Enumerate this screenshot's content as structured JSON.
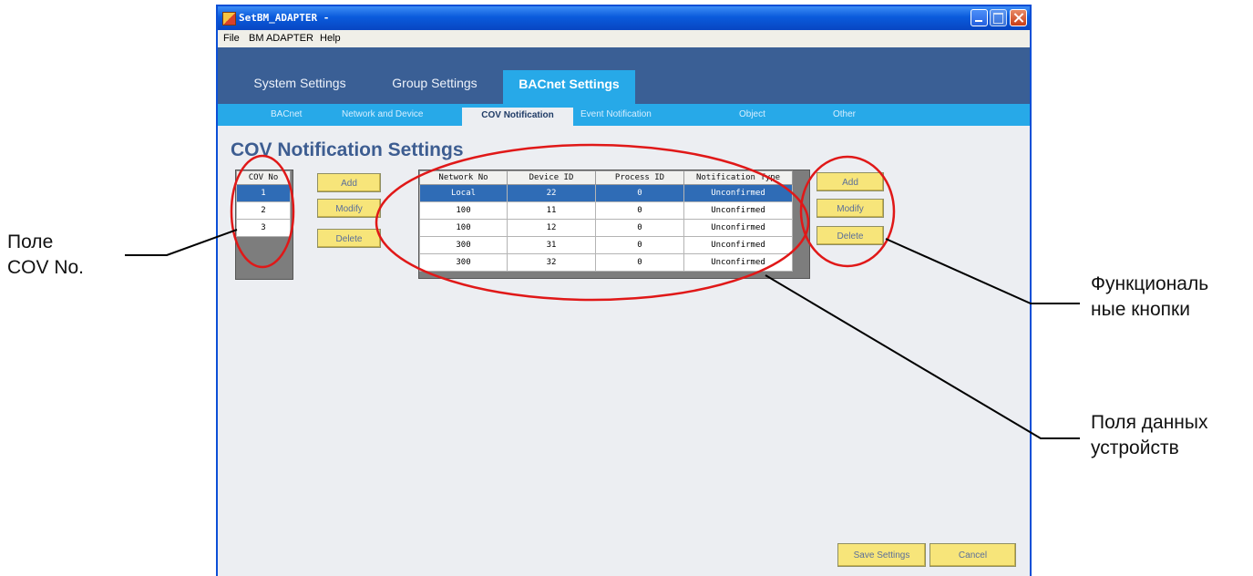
{
  "window": {
    "title": "SetBM_ADAPTER -",
    "menu": [
      "File",
      "BM ADAPTER",
      "Help"
    ]
  },
  "tabs": {
    "main": [
      "System Settings",
      "Group Settings",
      "BACnet Settings"
    ],
    "sub": [
      "BACnet",
      "Network and Device",
      "COV Notification",
      "Event Notification",
      "Object",
      "Other"
    ]
  },
  "page_title": "COV Notification Settings",
  "cov_list": {
    "header": "COV No",
    "items": [
      "1",
      "2",
      "3"
    ],
    "selected": "1"
  },
  "device_table": {
    "columns": [
      "Network No",
      "Device ID",
      "Process ID",
      "Notification Type"
    ],
    "rows": [
      [
        "Local",
        "22",
        "0",
        "Unconfirmed"
      ],
      [
        "100",
        "11",
        "0",
        "Unconfirmed"
      ],
      [
        "100",
        "12",
        "0",
        "Unconfirmed"
      ],
      [
        "300",
        "31",
        "0",
        "Unconfirmed"
      ],
      [
        "300",
        "32",
        "0",
        "Unconfirmed"
      ]
    ],
    "selected_row": 0
  },
  "buttons": {
    "add": "Add",
    "modify": "Modify",
    "delete": "Delete",
    "save": "Save Settings",
    "cancel": "Cancel"
  },
  "callouts": {
    "cov_field": [
      "Поле",
      "COV No."
    ],
    "function_buttons": [
      "Функциональ",
      "ные кнопки"
    ],
    "device_fields": [
      "Поля данных",
      "устройств"
    ]
  },
  "colors": {
    "title_blue": "#3d5d91",
    "main_tab_bar": "#3a5f95",
    "active_tab": "#27a9e8",
    "button_yellow": "#f7e57a",
    "highlight_red": "#e01818"
  }
}
